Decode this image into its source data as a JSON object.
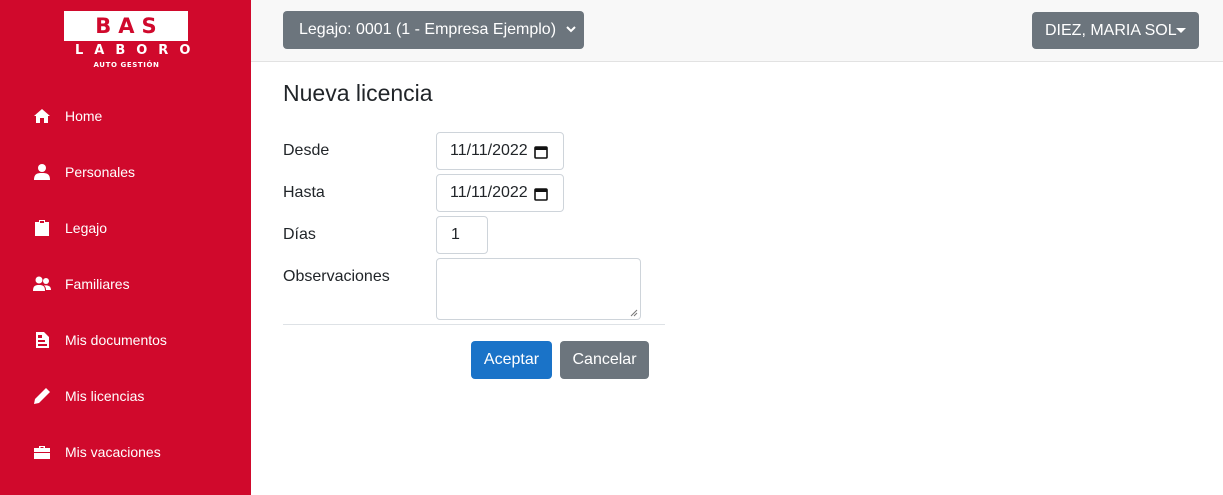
{
  "brand": {
    "line1": "BAS",
    "line2": "LABORO",
    "line3": "AUTO GESTIÓN",
    "color": "#d0092c"
  },
  "sidebar": {
    "items": [
      {
        "label": "Home",
        "icon": "home-icon"
      },
      {
        "label": "Personales",
        "icon": "user-icon"
      },
      {
        "label": "Legajo",
        "icon": "clipboard-icon"
      },
      {
        "label": "Familiares",
        "icon": "users-icon"
      },
      {
        "label": "Mis documentos",
        "icon": "document-icon"
      },
      {
        "label": "Mis licencias",
        "icon": "pencil-icon"
      },
      {
        "label": "Mis vacaciones",
        "icon": "briefcase-icon"
      }
    ]
  },
  "header": {
    "legajo_select": "Legajo: 0001 (1 - Empresa Ejemplo)",
    "user_menu": "DIEZ, MARIA SOL"
  },
  "form": {
    "title": "Nueva licencia",
    "desde_label": "Desde",
    "desde_value": "11/11/2022",
    "hasta_label": "Hasta",
    "hasta_value": "11/11/2022",
    "dias_label": "Días",
    "dias_value": "1",
    "observaciones_label": "Observaciones",
    "observaciones_value": "",
    "accept_label": "Aceptar",
    "cancel_label": "Cancelar"
  },
  "colors": {
    "sidebar_bg": "#d0092c",
    "primary": "#1a73c8",
    "secondary": "#6c757d"
  }
}
